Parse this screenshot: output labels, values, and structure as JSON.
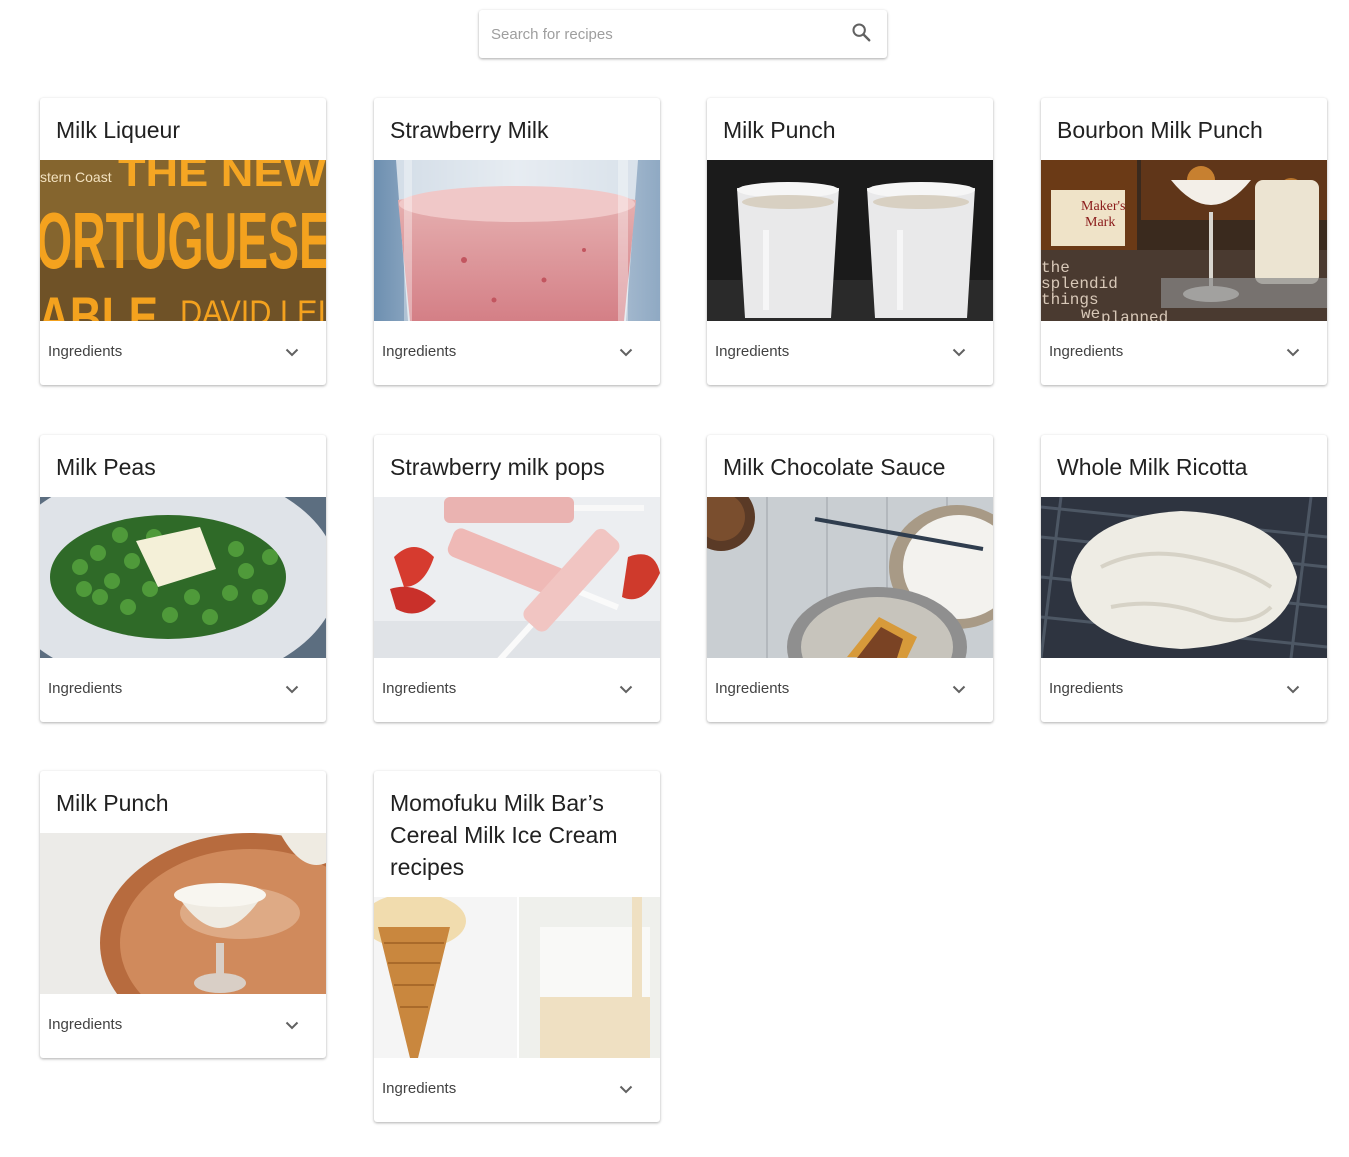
{
  "search": {
    "placeholder": "Search for recipes",
    "icon": "search-icon"
  },
  "cards": [
    {
      "title": "Milk Liqueur",
      "ingredients_label": "Ingredients",
      "image": "book-cover-portuguese-table"
    },
    {
      "title": "Strawberry Milk",
      "ingredients_label": "Ingredients",
      "image": "strawberry-milk-glass"
    },
    {
      "title": "Milk Punch",
      "ingredients_label": "Ingredients",
      "image": "two-glasses-milk-punch"
    },
    {
      "title": "Bourbon Milk Punch",
      "ingredients_label": "Ingredients",
      "image": "bourbon-bottle-and-cocktail",
      "image_text": [
        "Maker's",
        "Mark",
        "the",
        "splendid",
        "things",
        "we",
        "planned"
      ]
    },
    {
      "title": "Milk Peas",
      "ingredients_label": "Ingredients",
      "image": "peas-with-butter-plate"
    },
    {
      "title": "Strawberry milk pops",
      "ingredients_label": "Ingredients",
      "image": "strawberry-popsicles"
    },
    {
      "title": "Milk Chocolate Sauce",
      "ingredients_label": "Ingredients",
      "image": "cream-bowl-and-tart"
    },
    {
      "title": "Whole Milk Ricotta",
      "ingredients_label": "Ingredients",
      "image": "ricotta-in-cloth"
    },
    {
      "title": "Milk Punch",
      "ingredients_label": "Ingredients",
      "image": "milk-punch-on-copper-tray"
    },
    {
      "title": "Momofuku Milk Bar’s Cereal Milk Ice Cream recipes",
      "ingredients_label": "Ingredients",
      "image": "ice-cream-cone-and-cereal-milk"
    }
  ],
  "book_cover_text": {
    "line1": "stern Coast",
    "line2": "THE NEW",
    "line3": "ORTUGUESE",
    "line4": "ABLE",
    "line5": "DAVID LEI"
  },
  "colors": {
    "title_text": "#212121",
    "secondary_text": "#424242",
    "placeholder": "#9e9e9e",
    "icon": "#616161"
  }
}
